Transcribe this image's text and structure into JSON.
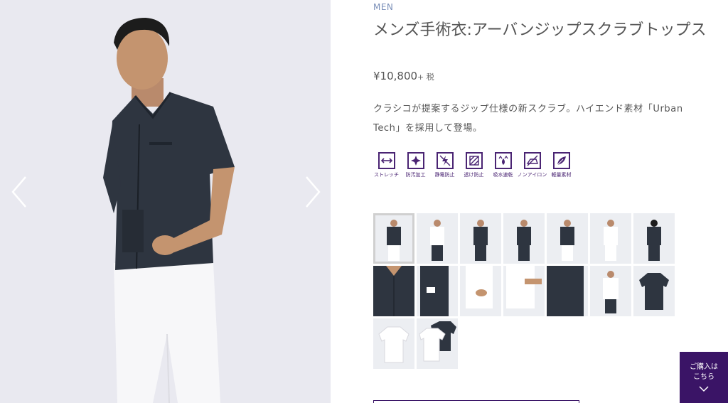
{
  "product": {
    "category": "MEN",
    "title": "メンズ手術衣:アーバンジップスクラブトップス",
    "price": "¥10,800",
    "tax": "+ 税",
    "description": "クラシコが提案するジップ仕様の新スクラブ。ハイエンド素材「Urban Tech」を採用して登場。"
  },
  "features": [
    {
      "label": "ストレッチ",
      "icon": "stretch-icon"
    },
    {
      "label": "防汚加工",
      "icon": "stain-resistant-icon"
    },
    {
      "label": "静電防止",
      "icon": "antistatic-icon"
    },
    {
      "label": "透け防止",
      "icon": "anti-see-through-icon"
    },
    {
      "label": "吸水速乾",
      "icon": "quick-dry-icon"
    },
    {
      "label": "ノンアイロン",
      "icon": "non-iron-icon"
    },
    {
      "label": "軽量素材",
      "icon": "lightweight-icon"
    }
  ],
  "gallery": {
    "prev_icon": "chevron-left-icon",
    "next_icon": "chevron-right-icon",
    "thumbnail_count": 16,
    "selected_index": 0
  },
  "purchase": {
    "label_line1": "ご購入は",
    "label_line2": "こちら",
    "icon": "chevron-down-icon"
  },
  "colors": {
    "brand": "#3a1466",
    "scrub_navy": "#2e3540",
    "background": "#e9e9f0"
  }
}
